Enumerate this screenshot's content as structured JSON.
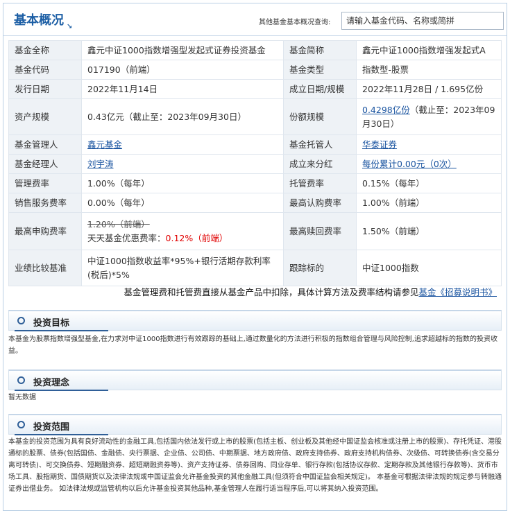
{
  "header": {
    "title": "基本概况",
    "search_label": "其他基金基本概况查询:",
    "search_placeholder": "请输入基金代码、名称或简拼"
  },
  "rows": [
    {
      "k1": "基金全称",
      "v1": "鑫元中证1000指数增强型发起式证券投资基金",
      "k2": "基金简称",
      "v2": "鑫元中证1000指数增强发起式A"
    },
    {
      "k1": "基金代码",
      "v1": "017190（前端）",
      "k2": "基金类型",
      "v2": "指数型-股票"
    },
    {
      "k1": "发行日期",
      "v1": "2022年11月14日",
      "k2": "成立日期/规模",
      "v2": "2022年11月28日 / 1.695亿份"
    },
    {
      "k1": "资产规模",
      "v1": "0.43亿元（截止至：2023年09月30日）",
      "k2": "份额规模",
      "v2_link": "0.4298亿份",
      "v2_rest": "（截止至：2023年09月30日）"
    },
    {
      "k1": "基金管理人",
      "v1_link": "鑫元基金",
      "k2": "基金托管人",
      "v2_link": "华泰证券"
    },
    {
      "k1": "基金经理人",
      "v1_link": "刘宇涛",
      "k2": "成立来分红",
      "v2_link": "每份累计0.00元（0次）"
    },
    {
      "k1": "管理费率",
      "v1": "1.00%（每年）",
      "k2": "托管费率",
      "v2": "0.15%（每年）"
    },
    {
      "k1": "销售服务费率",
      "v1": "0.00%（每年）",
      "k2": "最高认购费率",
      "v2": "1.00%（前端）"
    },
    {
      "k1": "最高申购费率",
      "v1_strike": "1.20%（前端）",
      "v1_pre": "天天基金优惠费率：",
      "v1_red": "0.12%（前端）",
      "k2": "最高赎回费率",
      "v2": "1.50%（前端）"
    },
    {
      "k1": "业绩比较基准",
      "v1": "中证1000指数收益率*95%+银行活期存款利率(税后)*5%",
      "k2": "跟踪标的",
      "v2": "中证1000指数"
    }
  ],
  "note": {
    "text": "基金管理费和托管费直接从基金产品中扣除，具体计算方法及费率结构请参见",
    "link": "基金《招募说明书》"
  },
  "sections": [
    {
      "title": "投资目标",
      "body": "本基金为股票指数增强型基金,在力求对中证1000指数进行有效跟踪的基础上,通过数量化的方法进行积极的指数组合管理与风险控制,追求超越标的指数的投资收益。"
    },
    {
      "title": "投资理念",
      "body": "暂无数据"
    },
    {
      "title": "投资范围",
      "body": "本基金的投资范围为具有良好流动性的金融工具,包括国内依法发行或上市的股票(包括主板、创业板及其他经中国证监会核准或注册上市的股票)、存托凭证、港股通标的股票、债券(包括国债、金融债、央行票据、企业债、公司债、中期票据、地方政府债、政府支持债券、政府支持机构债券、次级债、可转换债券(含交易分离可转债)、可交换债券、短期融资券、超短期融资券等)、资产支持证券、债券回购、同业存单、银行存款(包括协议存款、定期存款及其他银行存款等)、货币市场工具、股指期货、国债期货以及法律法规或中国证监会允许基金投资的其他金融工具(但须符合中国证监会相关规定)。 本基金可根据法律法规的规定参与转融通证券出借业务。 如法律法规或监管机构以后允许基金投资其他品种,基金管理人在履行适当程序后,可以将其纳入投资范围。"
    }
  ]
}
